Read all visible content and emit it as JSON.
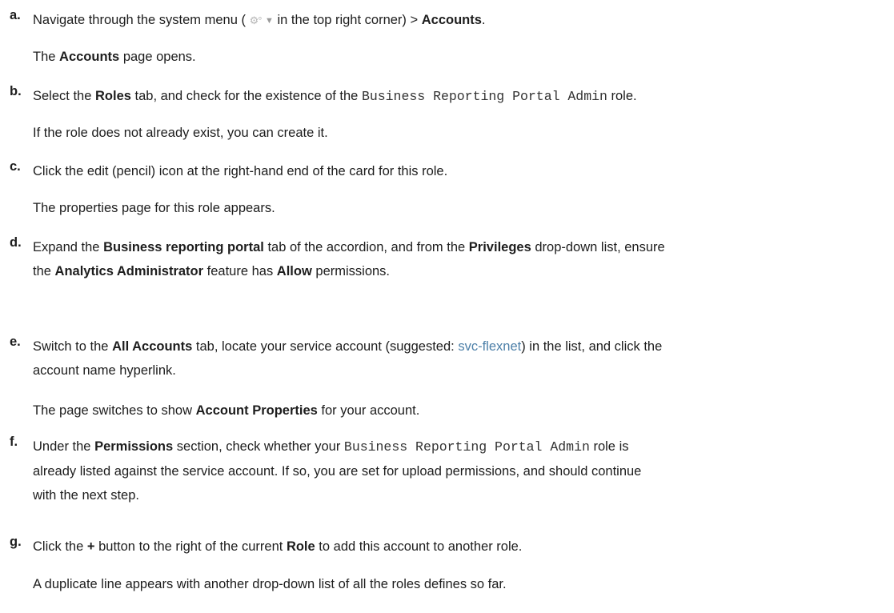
{
  "steps": {
    "a": {
      "label": "a.",
      "t1": "Navigate through the system menu (",
      "t2": "in the top right corner) >",
      "b1": "Accounts",
      "t3": ".",
      "note": {
        "t1": "The",
        "b1": "Accounts",
        "t2": "page opens."
      }
    },
    "b": {
      "label": "b.",
      "t1": "Select the",
      "b1": "Roles",
      "t2": "tab, and check for the existence of the",
      "code": "Business Reporting Portal Admin",
      "t3": "role.",
      "note": "If the role does not already exist, you can create it."
    },
    "c": {
      "label": "c.",
      "t1": "Click the edit (pencil) icon at the right-hand end of the card for this role.",
      "note": "The properties page for this role appears."
    },
    "d": {
      "label": "d.",
      "t1": "Expand the",
      "b1": "Business reporting portal",
      "t2": "tab of the accordion, and from the",
      "b2": "Privileges",
      "t3": "drop-down list, ensure",
      "t4": "the",
      "b3": "Analytics Administrator",
      "t5": "feature has",
      "b4": "Allow",
      "t6": "permissions."
    },
    "e": {
      "label": "e.",
      "t1": "Switch to the",
      "b1": "All Accounts",
      "t2": "tab, locate your service account (suggested:",
      "link": "svc-flexnet",
      "t3": ") in the list, and click the",
      "t4": "account name hyperlink.",
      "note": {
        "t1": "The page switches to show",
        "b1": "Account Properties",
        "t2": "for your account."
      }
    },
    "f": {
      "label": "f.",
      "t1": "Under the",
      "b1": "Permissions",
      "t2": "section, check whether your",
      "code": "Business Reporting Portal Admin",
      "t3": "role is",
      "t4": "already listed against the service account. If so, you are set for upload permissions, and should continue",
      "t5": "with the next step."
    },
    "g": {
      "label": "g.",
      "t1": "Click the",
      "b1": "+",
      "t2": "button to the right of the current",
      "b2": "Role",
      "t3": "to add this account to another role.",
      "note": "A duplicate line appears with another drop-down list of all the roles defines so far."
    }
  },
  "icons": {
    "system_menu": "gear-icon",
    "dropdown": "caret-down-icon"
  }
}
